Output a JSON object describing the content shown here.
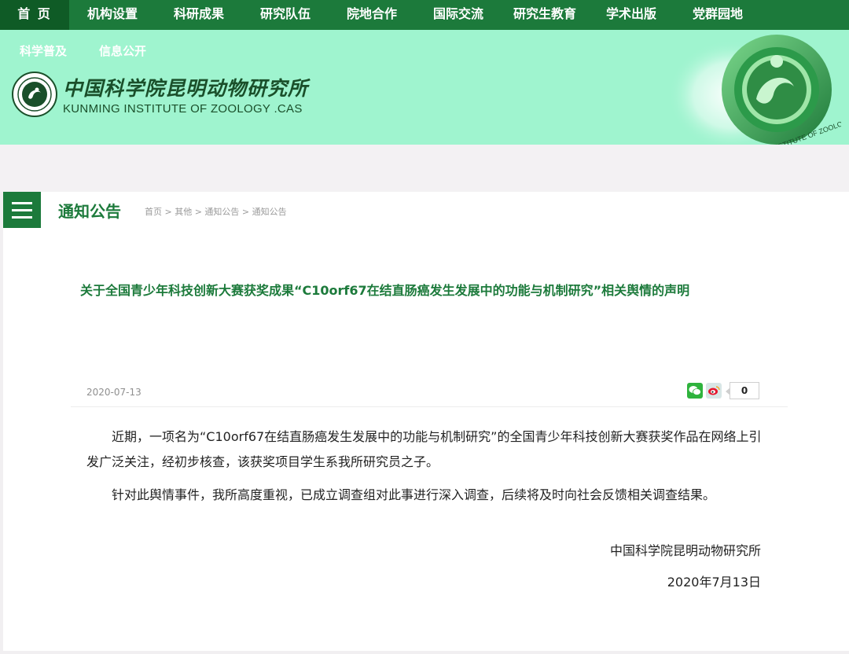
{
  "nav": {
    "items": [
      "首 页",
      "机构设置",
      "科研成果",
      "研究队伍",
      "院地合作",
      "国际交流",
      "研究生教育",
      "学术出版",
      "党群园地"
    ],
    "active_index": 0
  },
  "subnav": {
    "items": [
      "科学普及",
      "信息公开"
    ]
  },
  "logo": {
    "cn": "中国科学院昆明动物研究所",
    "en": "KUNMING INSTITUTE OF ZOOLOGY .CAS"
  },
  "seal": {
    "text": "KUNMING INSTITUTE OF ZOOLOGY"
  },
  "section": {
    "title": "通知公告",
    "breadcrumb": "首页 > 其他 > 通知公告 > 通知公告"
  },
  "article": {
    "title": "关于全国青少年科技创新大赛获奖成果“C10orf67在结直肠癌发生发展中的功能与机制研究”相关舆情的声明",
    "date": "2020-07-13",
    "share_count": "0",
    "paragraphs": [
      "近期，一项名为“C10orf67在结直肠癌发生发展中的功能与机制研究”的全国青少年科技创新大赛获奖作品在网络上引发广泛关注，经初步核查，该获奖项目学生系我所研究员之子。",
      "针对此舆情事件，我所高度重视，已成立调查组对此事进行深入调查，后续将及时向社会反馈相关调查结果。"
    ],
    "signature_org": "中国科学院昆明动物研究所",
    "signature_date": "2020年7月13日"
  },
  "colors": {
    "nav_bg": "#1c7a3b",
    "nav_active": "#0f5b26",
    "banner_bg": "#9ff4cf",
    "accent_green": "#1c7a3b"
  },
  "icons": {
    "menu": "hamburger-menu-icon",
    "wechat": "wechat-share-icon",
    "weibo": "weibo-share-icon",
    "logo": "institute-emblem-icon"
  }
}
